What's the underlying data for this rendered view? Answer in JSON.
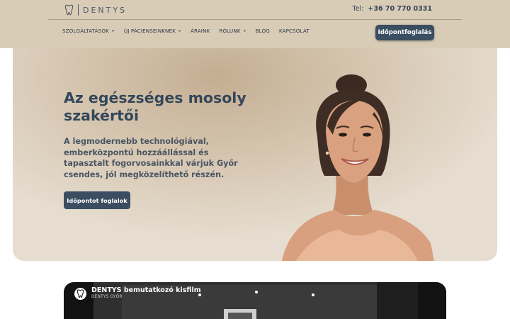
{
  "header": {
    "logo_text": "DENTYS",
    "phone_label": "Tel:",
    "phone_number": "+36 70 770 0331",
    "book_button": "Időpontfoglalás"
  },
  "nav": {
    "items": [
      {
        "label": "SZOLGÁLTATÁSOK",
        "has_dropdown": true
      },
      {
        "label": "ÚJ PÁCIENSEINKNEK",
        "has_dropdown": true
      },
      {
        "label": "ÁRAINK",
        "has_dropdown": false
      },
      {
        "label": "RÓLUNK",
        "has_dropdown": true
      },
      {
        "label": "BLOG",
        "has_dropdown": false
      },
      {
        "label": "KAPCSOLAT",
        "has_dropdown": false
      }
    ]
  },
  "hero": {
    "title_line1": "Az egészséges mosoly",
    "title_line2": "szakértői",
    "text": "A legmodernebb technológiával, emberközpontú hozzáállással és tapasztalt fogorvosainkkal várjuk Győr csendes, jól megközelíthető részén.",
    "cta": "Időpontot foglalok"
  },
  "video": {
    "title": "DENTYS bemutatkozó kisfilm",
    "channel": "DENTYS GYŐR"
  },
  "colors": {
    "header_bg": "#d9ccb7",
    "accent": "#3b4d60",
    "heading": "#34475a"
  },
  "icons": {
    "logo": "tooth-icon",
    "dropdown": "chevron-down-icon",
    "video_channel": "tooth-icon"
  }
}
